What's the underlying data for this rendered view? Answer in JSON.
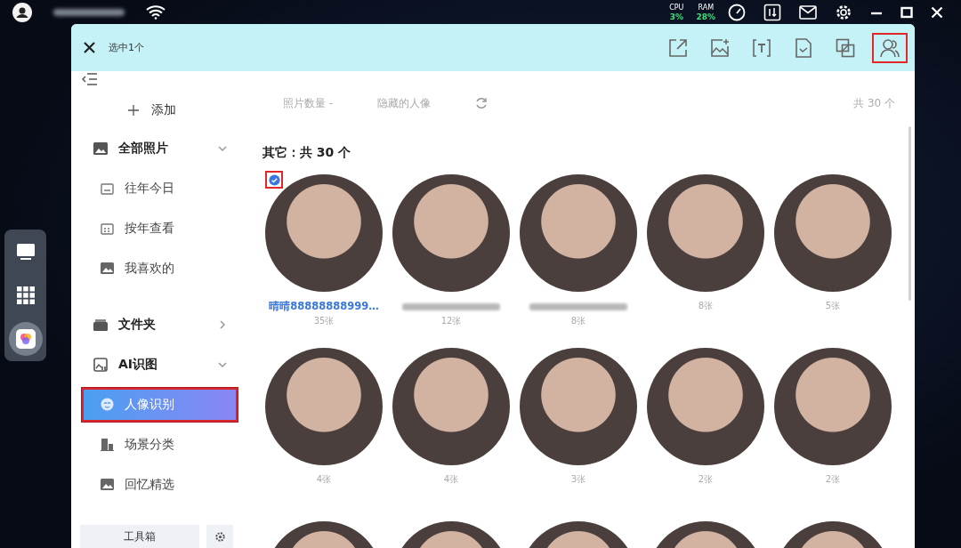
{
  "status_bar": {
    "cpu_label": "CPU",
    "cpu_value": "3%",
    "ram_label": "RAM",
    "ram_value": "28%"
  },
  "dock": [
    {
      "kind": "monitor",
      "selected": false
    },
    {
      "kind": "grid",
      "selected": false
    },
    {
      "kind": "photos",
      "selected": true
    }
  ],
  "header": {
    "selection": "选中1个",
    "tools": [
      {
        "kind": "export",
        "highlighted": false
      },
      {
        "kind": "image-add",
        "highlighted": false
      },
      {
        "kind": "text",
        "highlighted": false
      },
      {
        "kind": "document",
        "highlighted": false
      },
      {
        "kind": "overlap",
        "highlighted": false
      },
      {
        "kind": "person",
        "highlighted": true
      }
    ]
  },
  "sidebar": {
    "add_label": "添加",
    "groups": [
      {
        "label": "全部照片",
        "expanded": true,
        "children": [
          {
            "label": "往年今日",
            "selected": false
          },
          {
            "label": "按年查看",
            "selected": false
          },
          {
            "label": "我喜欢的",
            "selected": false
          }
        ]
      },
      {
        "label": "文件夹",
        "expanded": false
      },
      {
        "label": "AI识图",
        "expanded": true,
        "children": [
          {
            "label": "人像识别",
            "selected": true
          },
          {
            "label": "场景分类",
            "selected": false
          },
          {
            "label": "回忆精选",
            "selected": false
          }
        ]
      }
    ],
    "toolbox_label": "工具箱"
  },
  "filters": {
    "sort": "照片数量 -",
    "hidden": "隐藏的人像",
    "total": "共 30 个"
  },
  "section_title": "其它：共 30 个",
  "people": [
    {
      "name": "晴晴88888888999…",
      "name_blurred": false,
      "count": "35张",
      "selected": true
    },
    {
      "name_blurred": true,
      "count": "12张",
      "selected": false
    },
    {
      "name_blurred": true,
      "count": "8张",
      "selected": false
    },
    {
      "name_blurred": false,
      "count": "8张",
      "selected": false
    },
    {
      "name_blurred": false,
      "count": "5张",
      "selected": false
    },
    {
      "name_blurred": false,
      "count": "4张",
      "selected": false
    },
    {
      "name_blurred": false,
      "count": "4张",
      "selected": false
    },
    {
      "name_blurred": false,
      "count": "3张",
      "selected": false
    },
    {
      "name_blurred": false,
      "count": "2张",
      "selected": false
    },
    {
      "name_blurred": false,
      "count": "2张",
      "selected": false
    },
    {
      "selected": false
    },
    {
      "selected": false
    },
    {
      "selected": false
    },
    {
      "selected": false
    },
    {
      "selected": false
    }
  ]
}
